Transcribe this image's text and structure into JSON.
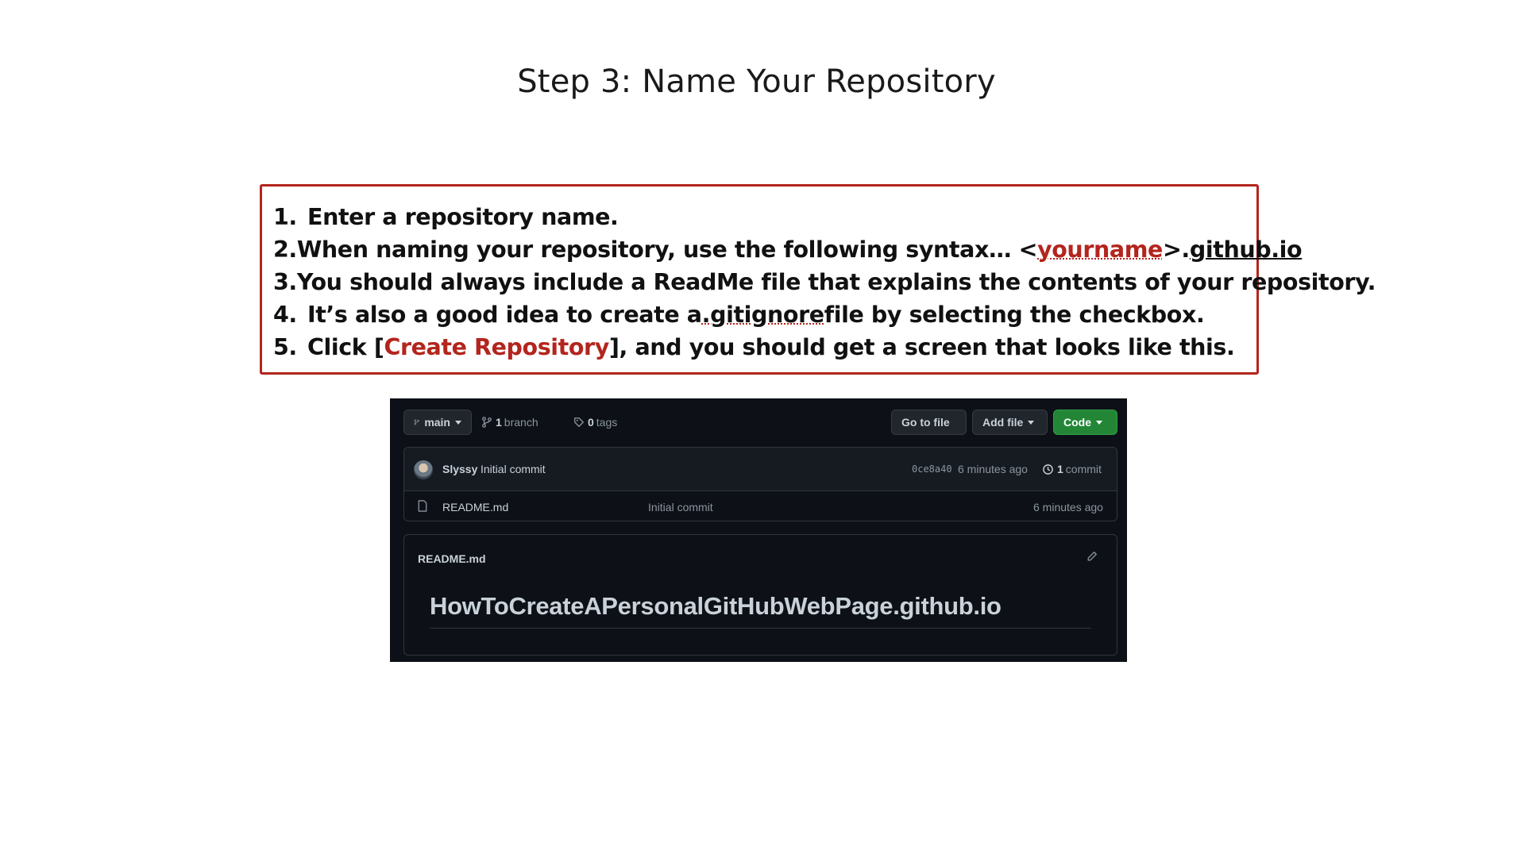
{
  "slide": {
    "title": "Step 3: Name Your Repository"
  },
  "instructions": {
    "items": [
      {
        "num": "1.",
        "parts": [
          "Enter a repository name."
        ]
      },
      {
        "num": "2.",
        "parts": [
          "When naming your repository, use the following syntax… <",
          "yourname",
          ">.",
          "github.io"
        ]
      },
      {
        "num": "3.",
        "parts": [
          "You should always include a ReadMe file that explains the contents of your repository."
        ]
      },
      {
        "num": "4.",
        "parts": [
          "It’s also a good idea to create a ",
          ".gitignore",
          " file by selecting the checkbox."
        ]
      },
      {
        "num": "5.",
        "parts": [
          "Click [",
          "Create Repository",
          "], and you should get a screen that looks like this."
        ]
      }
    ],
    "accent_color": "#b3251d"
  },
  "github": {
    "branch_button": "main",
    "branch_count": "1",
    "branch_label": "branch",
    "tag_count": "0",
    "tag_label": "tags",
    "go_to_file": "Go to file",
    "add_file": "Add file",
    "code": "Code",
    "commit": {
      "author": "Slyssy",
      "message": "Initial commit",
      "hash": "0ce8a40",
      "time": "6 minutes ago",
      "commit_count": "1",
      "commit_label": "commit"
    },
    "files": [
      {
        "name": "README.md",
        "message": "Initial commit",
        "time": "6 minutes ago"
      }
    ],
    "readme": {
      "filename": "README.md",
      "heading": "HowToCreateAPersonalGitHubWebPage.github.io"
    },
    "colors": {
      "background": "#0d1117",
      "green": "#238636"
    }
  }
}
